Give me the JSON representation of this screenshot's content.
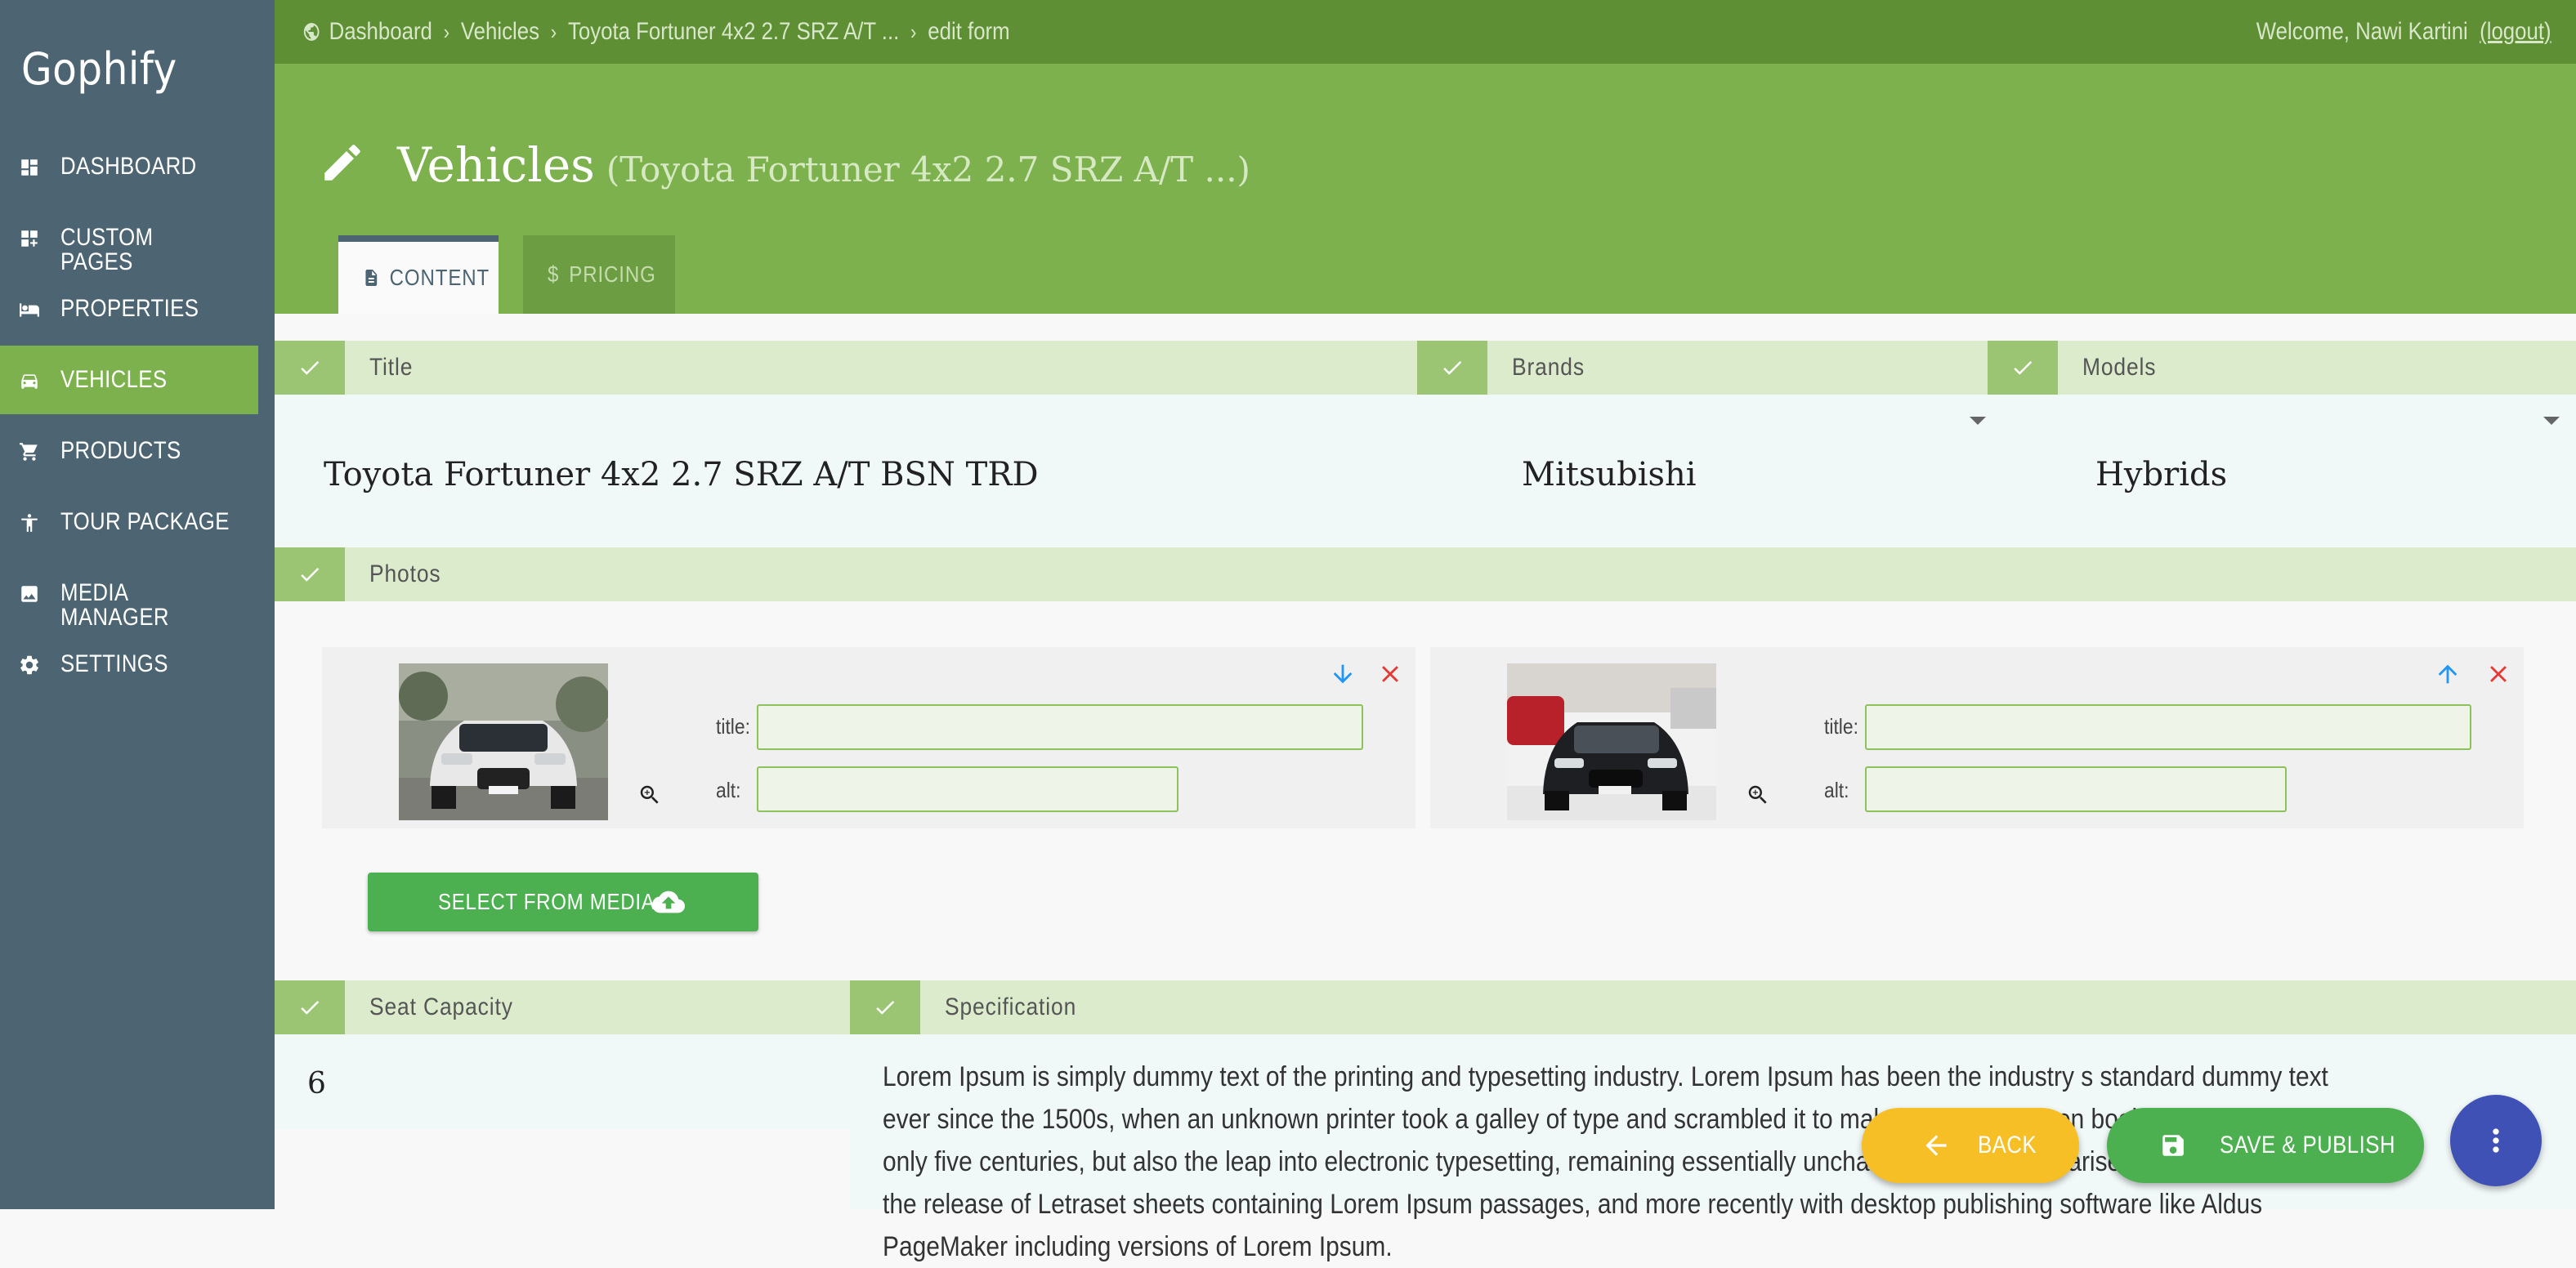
{
  "app": {
    "brand": "Gophify"
  },
  "sidebar": {
    "items": [
      {
        "label": "DASHBOARD",
        "icon": "dashboard-icon"
      },
      {
        "label": "CUSTOM PAGES",
        "icon": "custom-pages-icon"
      },
      {
        "label": "PROPERTIES",
        "icon": "bed-icon"
      },
      {
        "label": "VEHICLES",
        "icon": "car-icon",
        "active": true
      },
      {
        "label": "PRODUCTS",
        "icon": "cart-icon"
      },
      {
        "label": "TOUR PACKAGE",
        "icon": "person-icon"
      },
      {
        "label": "MEDIA MANAGER",
        "icon": "image-icon"
      },
      {
        "label": "SETTINGS",
        "icon": "gear-icon"
      }
    ]
  },
  "topbar": {
    "breadcrumbs": [
      "Dashboard",
      "Vehicles",
      "Toyota Fortuner 4x2 2.7 SRZ A/T ...",
      "edit form"
    ],
    "welcome": "Welcome, Nawi Kartini",
    "logout": "(logout)"
  },
  "header": {
    "title": "Vehicles",
    "subtitle": "(Toyota Fortuner 4x2 2.7 SRZ A/T ...)",
    "tabs": [
      {
        "label": "CONTENT",
        "icon": "document-icon",
        "active": true
      },
      {
        "label": "PRICING",
        "icon": "dollar-icon",
        "active": false
      }
    ]
  },
  "fields": {
    "title": {
      "label": "Title",
      "value": "Toyota Fortuner 4x2 2.7 SRZ A/T BSN TRD"
    },
    "brands": {
      "label": "Brands",
      "value": "Mitsubishi"
    },
    "models": {
      "label": "Models",
      "value": "Hybrids"
    },
    "photos": {
      "label": "Photos",
      "items": [
        {
          "title_label": "title:",
          "alt_label": "alt:",
          "title_value": "",
          "alt_value": "",
          "car_color": "#e8e8e8"
        },
        {
          "title_label": "title:",
          "alt_label": "alt:",
          "title_value": "",
          "alt_value": "",
          "car_color": "#1d1f22"
        }
      ],
      "select_button": "SELECT FROM MEDIA"
    },
    "seat_capacity": {
      "label": "Seat Capacity",
      "value": "6"
    },
    "specification": {
      "label": "Specification",
      "text": "Lorem Ipsum is simply dummy text of the printing and typesetting industry. Lorem Ipsum has been the industry s standard dummy text ever since the 1500s, when an unknown printer took a galley of type and scrambled it to make a type specimen book. It has survived not only five centuries, but also the leap into electronic typesetting, remaining essentially unchanged. It was popularised in the 1960s with the release of Letraset sheets containing Lorem Ipsum passages, and more recently with desktop publishing software like Aldus PageMaker including versions of Lorem Ipsum."
    }
  },
  "actions": {
    "back": "BACK",
    "save": "SAVE & PUBLISH"
  },
  "colors": {
    "sidebar": "#4d6572",
    "accent": "#7cb14d",
    "topbar": "#5f8f35",
    "save": "#4caf50",
    "back": "#f6bf26",
    "more": "#3f51b5",
    "delete": "#e53935",
    "move": "#2196f3"
  }
}
